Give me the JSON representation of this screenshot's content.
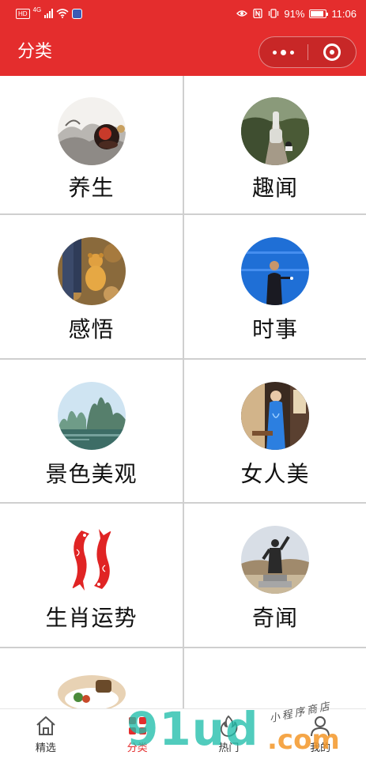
{
  "status_bar": {
    "hd": "HD",
    "network": "4G",
    "battery": "91%",
    "time": "11:06"
  },
  "header": {
    "title": "分类",
    "more_icon": "more-dots-icon",
    "close_icon": "target-close-icon",
    "accent_color": "#e42d2d"
  },
  "categories": [
    {
      "label": "养生",
      "icon": "ink-landscape-tea-image"
    },
    {
      "label": "趣闻",
      "icon": "horse-road-image"
    },
    {
      "label": "感悟",
      "icon": "teddy-bear-leaves-image"
    },
    {
      "label": "时事",
      "icon": "speaker-on-stage-image"
    },
    {
      "label": "景色美观",
      "icon": "karst-mountains-river-image"
    },
    {
      "label": "女人美",
      "icon": "woman-qipao-image"
    },
    {
      "label": "生肖运势",
      "icon": "red-koi-fish-image"
    },
    {
      "label": "奇闻",
      "icon": "warrior-statue-image"
    },
    {
      "label": "",
      "icon": "food-plate-image"
    }
  ],
  "tabs": [
    {
      "label": "精选",
      "icon": "home-icon"
    },
    {
      "label": "分类",
      "icon": "grid-icon",
      "active": true
    },
    {
      "label": "热门",
      "icon": "flame-icon"
    },
    {
      "label": "我的",
      "icon": "person-icon"
    }
  ],
  "watermark": {
    "main": "91ud",
    "suffix": ".com",
    "sub": "小程序商店"
  }
}
